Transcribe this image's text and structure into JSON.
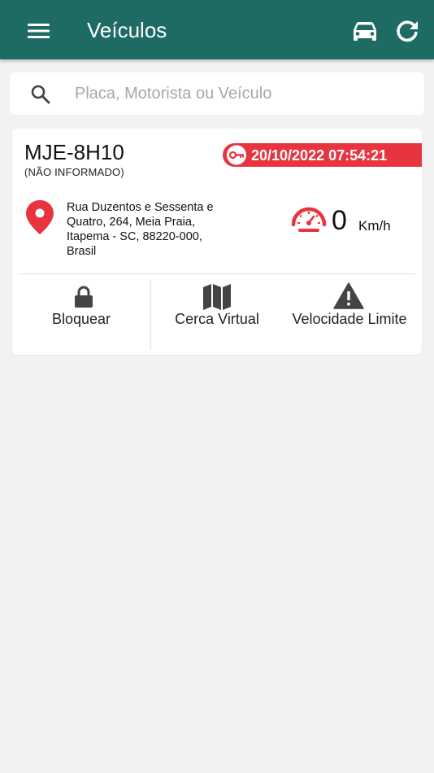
{
  "appbar": {
    "title": "Veículos",
    "menu_icon": "menu-icon",
    "car_icon": "car-icon",
    "refresh_icon": "refresh-icon",
    "color": "#1e6b64"
  },
  "search": {
    "placeholder": "Placa, Motorista ou Veículo",
    "value": "",
    "icon": "search-icon"
  },
  "vehicle": {
    "plate": "MJE-8H10",
    "driver": "(NÃO INFORMADO)",
    "ignition_icon": "key-icon",
    "datetime": "20/10/2022 07:54:21",
    "status_color": "#e8343f",
    "location_icon": "map-pin-icon",
    "address": "Rua Duzentos e Sessenta e Quatro, 264, Meia Praia, Itapema - SC, 88220-000, Brasil",
    "speed_icon": "speedometer-icon",
    "speed": "0",
    "speed_unit": "Km/h"
  },
  "actions": [
    {
      "label": "Bloquear",
      "icon": "lock-icon"
    },
    {
      "label": "Cerca Virtual",
      "icon": "map-icon"
    },
    {
      "label": "Velocidade Limite",
      "icon": "warning-icon"
    }
  ]
}
